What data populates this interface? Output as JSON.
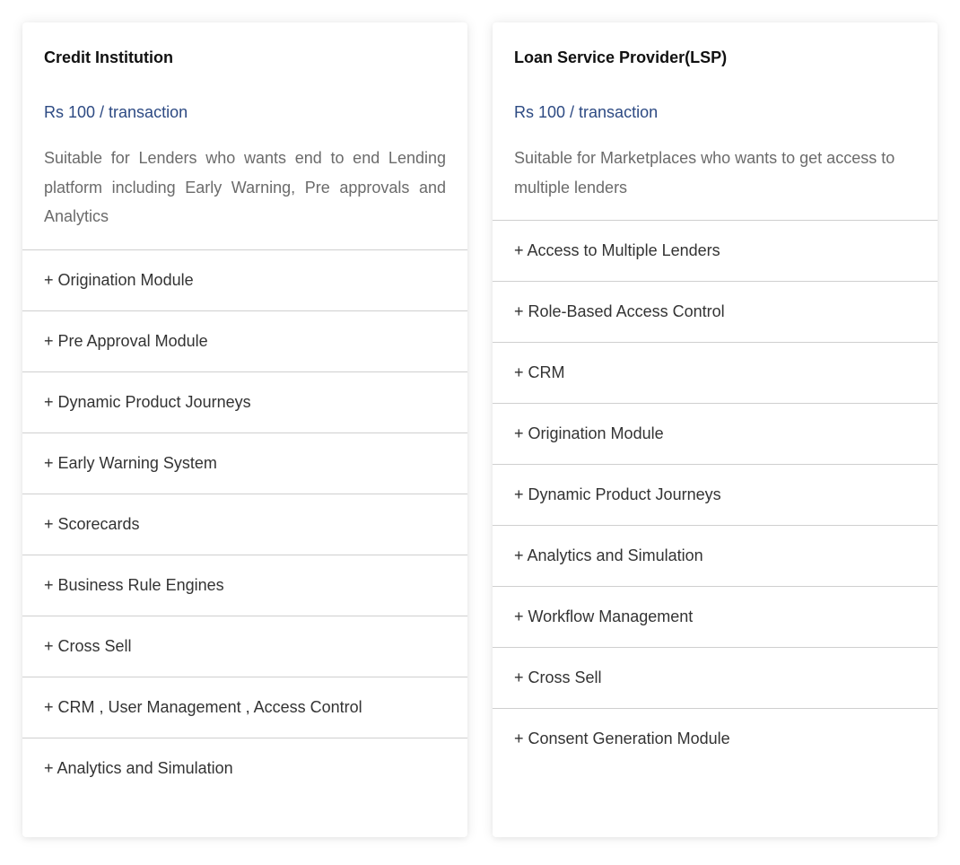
{
  "plans": [
    {
      "title": "Credit Institution",
      "price": "Rs 100 / transaction",
      "description": "Suitable for Lenders who wants end to end Lending platform including Early Warning, Pre approvals and Analytics",
      "features": [
        "+ Origination Module",
        "+ Pre Approval Module",
        "+ Dynamic Product Journeys",
        "+ Early Warning System",
        "+ Scorecards",
        "+ Business Rule Engines",
        "+ Cross Sell",
        "+ CRM , User Management , Access Control",
        "+ Analytics and Simulation"
      ]
    },
    {
      "title": "Loan Service Provider(LSP)",
      "price": "Rs 100 / transaction",
      "description": "Suitable for Marketplaces who wants to get access to multiple lenders",
      "features": [
        "+ Access to Multiple Lenders",
        "+ Role-Based Access Control",
        "+ CRM",
        "+ Origination Module",
        "+ Dynamic Product Journeys",
        "+ Analytics and Simulation",
        "+ Workflow Management",
        "+ Cross Sell",
        "+ Consent Generation Module"
      ]
    }
  ],
  "colors": {
    "price": "#2d4a83",
    "description": "#6b6b6b",
    "feature_text": "#333333",
    "divider": "#cfcfcf"
  }
}
